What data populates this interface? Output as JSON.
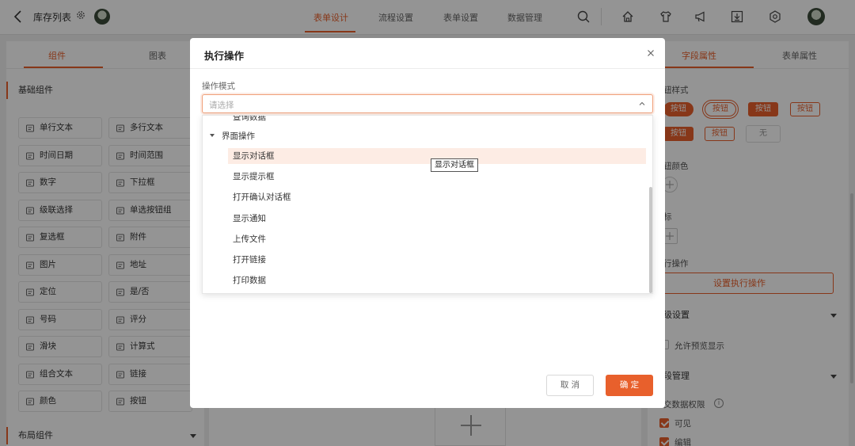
{
  "header": {
    "title": "库存列表",
    "nav_tabs": [
      "表单设计",
      "流程设置",
      "表单设置",
      "数据管理"
    ],
    "active_tab": "表单设计"
  },
  "left_panel": {
    "tabs": [
      "组件",
      "图表"
    ],
    "section_basic": "基础组件",
    "components": [
      {
        "label": "单行文本",
        "icon": "single-line-text-icon"
      },
      {
        "label": "多行文本",
        "icon": "multi-line-text-icon"
      },
      {
        "label": "时间日期",
        "icon": "calendar-icon"
      },
      {
        "label": "时间范围",
        "icon": "clock-icon"
      },
      {
        "label": "数字",
        "icon": "number-icon"
      },
      {
        "label": "下拉框",
        "icon": "dropdown-icon"
      },
      {
        "label": "级联选择",
        "icon": "cascade-icon"
      },
      {
        "label": "单选按钮组",
        "icon": "radio-icon"
      },
      {
        "label": "复选框",
        "icon": "checkbox-icon"
      },
      {
        "label": "附件",
        "icon": "paperclip-icon"
      },
      {
        "label": "图片",
        "icon": "image-icon"
      },
      {
        "label": "地址",
        "icon": "location-pin-icon"
      },
      {
        "label": "定位",
        "icon": "locate-icon"
      },
      {
        "label": "是/否",
        "icon": "toggle-icon"
      },
      {
        "label": "号码",
        "icon": "phone-icon"
      },
      {
        "label": "评分",
        "icon": "star-icon"
      },
      {
        "label": "滑块",
        "icon": "slider-icon"
      },
      {
        "label": "计算式",
        "icon": "formula-icon"
      },
      {
        "label": "组合文本",
        "icon": "combined-text-icon"
      },
      {
        "label": "链接",
        "icon": "link-icon"
      },
      {
        "label": "颜色",
        "icon": "palette-icon"
      },
      {
        "label": "按钮",
        "icon": "button-icon"
      }
    ],
    "section_layout": "布局组件"
  },
  "right_panel": {
    "tabs": [
      "字段属性",
      "表单属性"
    ],
    "button_style_label": "钮样式",
    "button_samples": [
      "按钮",
      "按钮",
      "按钮",
      "按钮",
      "按钮",
      "按钮",
      "无"
    ],
    "button_color_label": "钮颜色",
    "icon_label": "标",
    "exec_label": "行操作",
    "set_exec_button": "设置执行操作",
    "advanced_label": "级设置",
    "allow_preview": "允许预览显示",
    "field_manage_label": "段管理",
    "submit_perm_label": "交数据权限",
    "visible_label": "可见",
    "editable_label": "编辑",
    "accent_color": "#e8602c"
  },
  "modal": {
    "title": "执行操作",
    "field_label": "操作模式",
    "placeholder": "请选择",
    "partial_item": "查询数据",
    "group": "界面操作",
    "items": [
      "显示对话框",
      "显示提示框",
      "打开确认对话框",
      "显示通知",
      "上传文件",
      "打开链接",
      "打印数据"
    ],
    "hovered_item": "显示对话框",
    "tooltip": "显示对话框",
    "cancel": "取 消",
    "confirm": "确 定"
  }
}
